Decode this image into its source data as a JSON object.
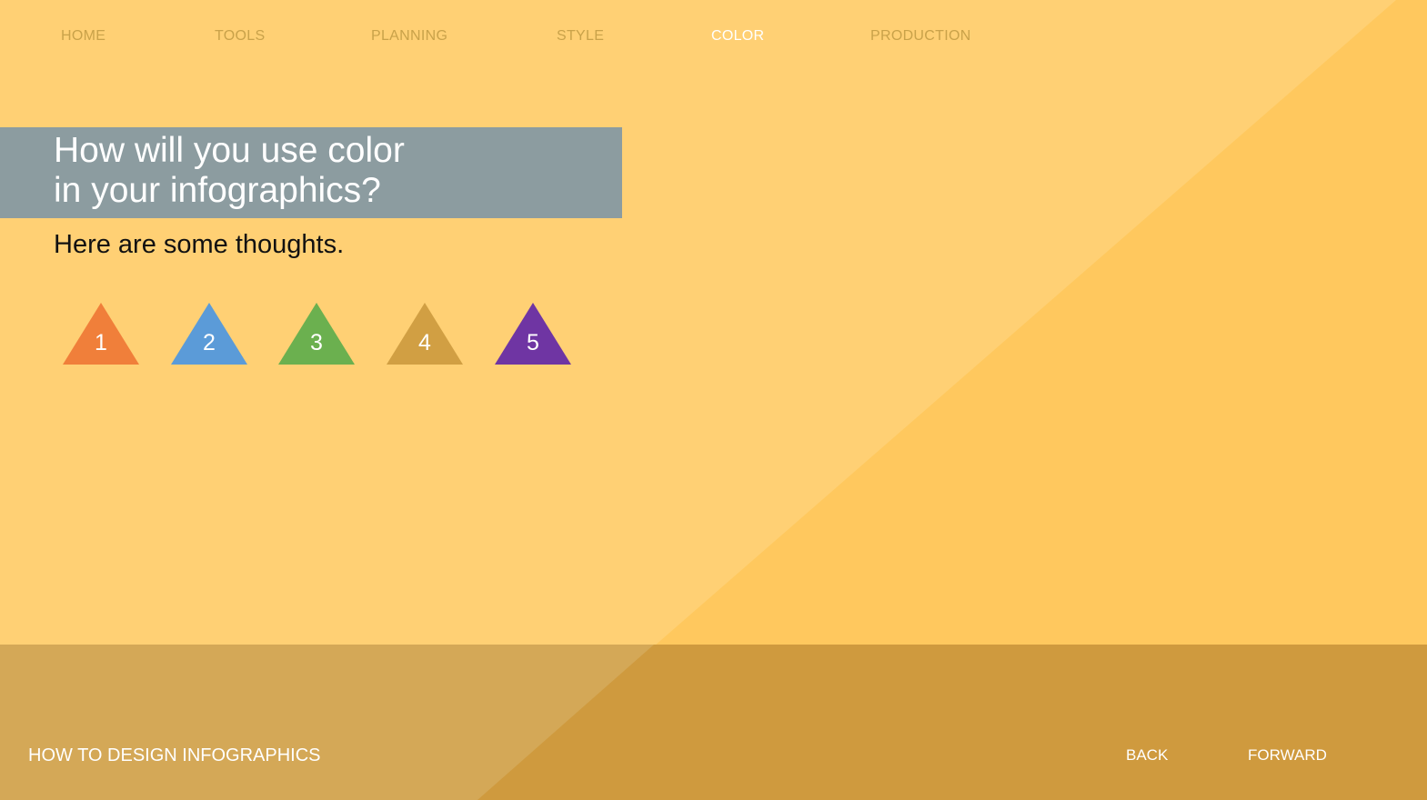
{
  "nav": {
    "items": [
      {
        "label": "HOME",
        "active": false
      },
      {
        "label": "TOOLS",
        "active": false
      },
      {
        "label": "PLANNING",
        "active": false
      },
      {
        "label": "STYLE",
        "active": false
      },
      {
        "label": "COLOR",
        "active": true
      },
      {
        "label": "PRODUCTION",
        "active": false
      }
    ]
  },
  "main": {
    "title_line1": "How will you use color",
    "title_line2": "in your infographics?",
    "subtitle": "Here are some thoughts."
  },
  "triangles": [
    {
      "label": "1",
      "color": "#f07f3a"
    },
    {
      "label": "2",
      "color": "#5b9bd8"
    },
    {
      "label": "3",
      "color": "#6bb04f"
    },
    {
      "label": "4",
      "color": "#d19f43"
    },
    {
      "label": "5",
      "color": "#6f35a3"
    }
  ],
  "footer": {
    "title": "HOW TO DESIGN INFOGRAPHICS",
    "back_label": "BACK",
    "forward_label": "FORWARD"
  },
  "colors": {
    "background_light": "#ffd074",
    "background_dark": "#ffc85e",
    "footer_light": "#d4a857",
    "footer_dark": "#cf9a3e",
    "title_band": "#8c9ca0",
    "nav_inactive": "#c9a24a",
    "nav_active": "#ffffff"
  }
}
